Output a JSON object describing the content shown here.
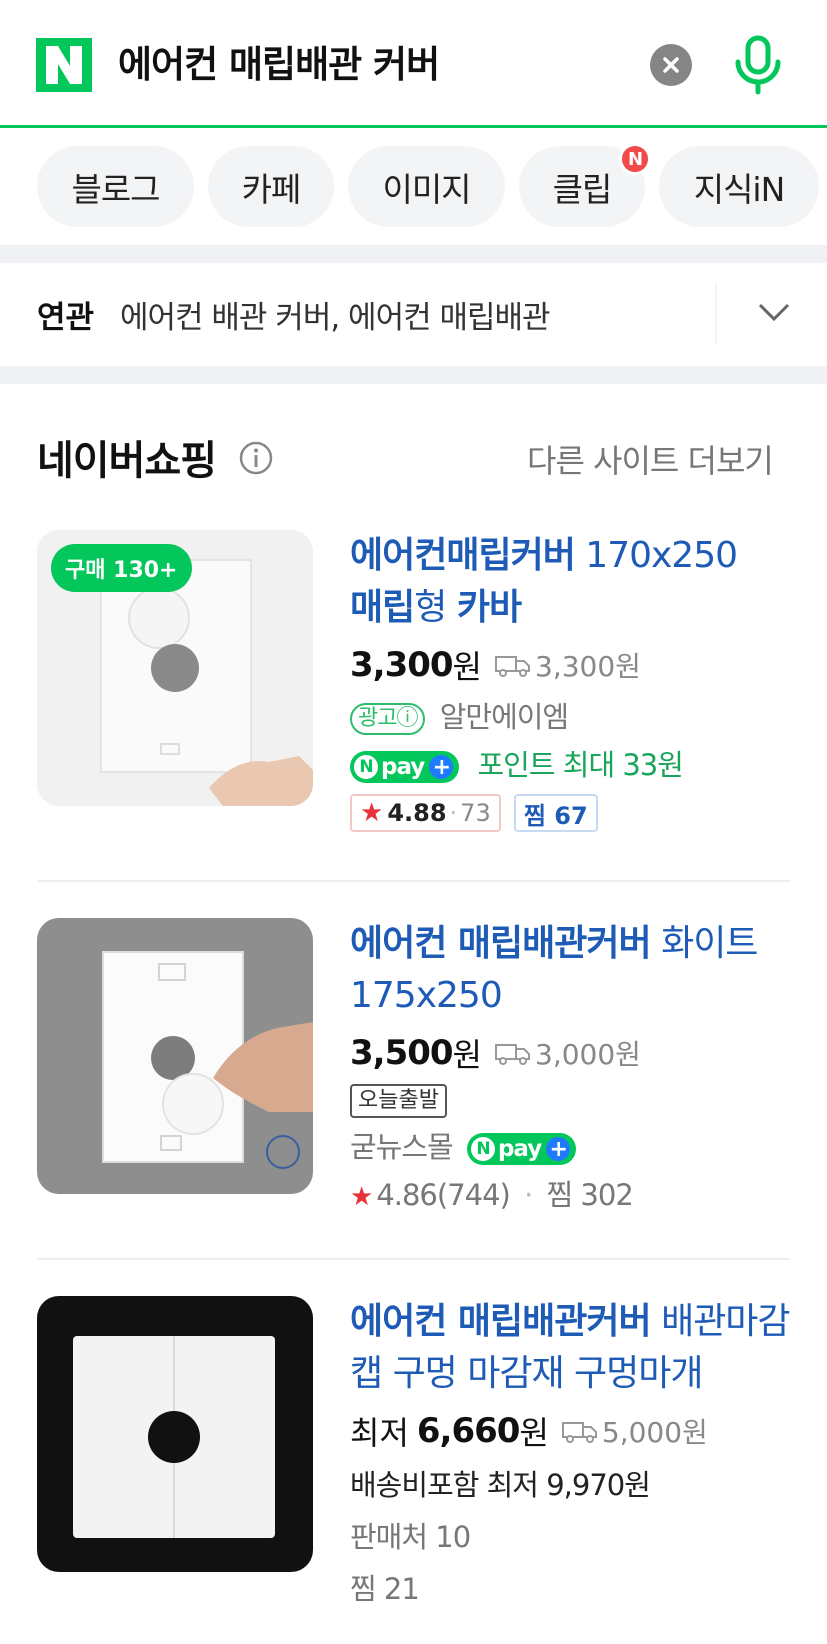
{
  "search": {
    "query": "에어컨 매립배관 커버",
    "icons": {
      "logo": "naver-n-logo",
      "clear": "clear-icon",
      "mic": "microphone-icon"
    },
    "brand_color": "#03c75a"
  },
  "tabs": [
    {
      "label": "블로그"
    },
    {
      "label": "카페"
    },
    {
      "label": "이미지"
    },
    {
      "label": "클립",
      "badge": "N"
    },
    {
      "label": "지식iN"
    }
  ],
  "related": {
    "label": "연관",
    "text": "에어컨 배관 커버, 에어컨 매립배관"
  },
  "shopping": {
    "title": "네이버쇼핑",
    "more": "다른 사이트 더보기",
    "products": [
      {
        "badge": "구매 130+",
        "title_bold": "에어컨매립커버",
        "title_rest": " 170x250",
        "title_line2_bold": "매립",
        "title_line2_mid": "형 ",
        "title_line2_bold2": "카바",
        "price": "3,300",
        "unit": "원",
        "shipping": "3,300원",
        "ad": "광고ⓘ",
        "seller": "알만에이엠",
        "npay": "pay",
        "points": "포인트 최대 33원",
        "rating": "4.88",
        "review_count": "73",
        "zzim": "찜 67"
      },
      {
        "title_bold": "에어컨 매립배관커버",
        "title_rest": " 화이트 175x250",
        "price": "3,500",
        "unit": "원",
        "shipping": "3,000원",
        "tag": "오늘출발",
        "seller": "굳뉴스몰",
        "npay": "pay",
        "rating": "4.86",
        "review_count": "(744)",
        "zzim": "찜 302"
      },
      {
        "title_bold": "에어컨 매립배관커버",
        "title_rest": " 배관마감캡 구멍 마감재 구멍마개",
        "price_prefix": "최저 ",
        "price": "6,660",
        "unit": "원",
        "shipping": "5,000원",
        "incl_shipping": "배송비포함 최저 9,970원",
        "sellers": "판매처 10",
        "zzim": "찜 21"
      }
    ]
  }
}
